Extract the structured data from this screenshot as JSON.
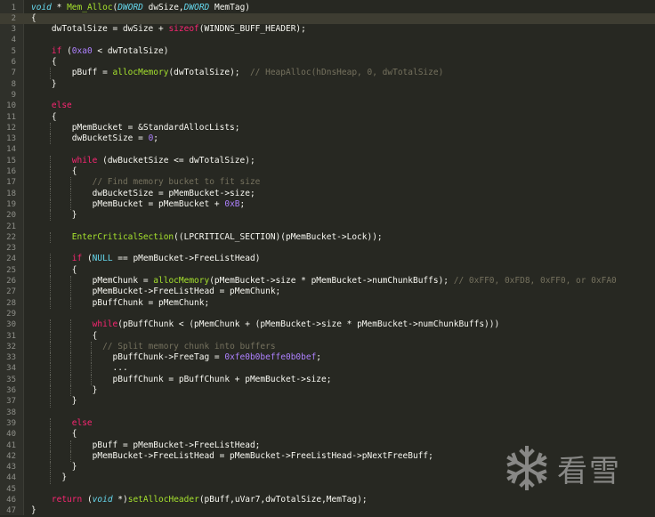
{
  "editor": {
    "current_line": 2,
    "lines": [
      {
        "n": "1",
        "t": [
          [
            "ty",
            "void"
          ],
          [
            "p",
            " * "
          ],
          [
            "fn",
            "Mem_Alloc"
          ],
          [
            "p",
            "("
          ],
          [
            "ty",
            "DWORD"
          ],
          [
            "p",
            " dwSize,"
          ],
          [
            "ty",
            "DWORD"
          ],
          [
            "p",
            " MemTag)"
          ]
        ]
      },
      {
        "n": "2",
        "t": [
          [
            "p",
            "{"
          ]
        ]
      },
      {
        "n": "3",
        "t": [
          [
            "p",
            "    dwTotalSize = dwSize + "
          ],
          [
            "kw",
            "sizeof"
          ],
          [
            "p",
            "(WINDNS_BUFF_HEADER);"
          ]
        ]
      },
      {
        "n": "4",
        "t": []
      },
      {
        "n": "5",
        "t": [
          [
            "p",
            "    "
          ],
          [
            "kw",
            "if"
          ],
          [
            "p",
            " ("
          ],
          [
            "num",
            "0xa0"
          ],
          [
            "p",
            " < dwTotalSize)"
          ]
        ]
      },
      {
        "n": "6",
        "t": [
          [
            "p",
            "    {"
          ]
        ]
      },
      {
        "n": "7",
        "t": [
          [
            "p",
            "        pBuff = "
          ],
          [
            "fn",
            "allocMemory"
          ],
          [
            "p",
            "(dwTotalSize);  "
          ],
          [
            "cmt",
            "// HeapAlloc(hDnsHeap, 0, dwTotalSize)"
          ]
        ]
      },
      {
        "n": "8",
        "t": [
          [
            "p",
            "    }"
          ]
        ]
      },
      {
        "n": "9",
        "t": []
      },
      {
        "n": "10",
        "t": [
          [
            "p",
            "    "
          ],
          [
            "kw",
            "else"
          ]
        ]
      },
      {
        "n": "11",
        "t": [
          [
            "p",
            "    {"
          ]
        ]
      },
      {
        "n": "12",
        "t": [
          [
            "p",
            "        pMemBucket = &StandardAllocLists;"
          ]
        ]
      },
      {
        "n": "13",
        "t": [
          [
            "p",
            "        dwBucketSize = "
          ],
          [
            "num",
            "0"
          ],
          [
            "p",
            ";"
          ]
        ]
      },
      {
        "n": "14",
        "t": []
      },
      {
        "n": "15",
        "t": [
          [
            "p",
            "        "
          ],
          [
            "kw",
            "while"
          ],
          [
            "p",
            " (dwBucketSize <= dwTotalSize);"
          ]
        ]
      },
      {
        "n": "16",
        "t": [
          [
            "p",
            "        {"
          ]
        ]
      },
      {
        "n": "17",
        "t": [
          [
            "p",
            "            "
          ],
          [
            "cmt",
            "// Find memory bucket to fit size"
          ]
        ]
      },
      {
        "n": "18",
        "t": [
          [
            "p",
            "            dwBucketSize = pMemBucket->size;"
          ]
        ]
      },
      {
        "n": "19",
        "t": [
          [
            "p",
            "            pMemBucket = pMemBucket + "
          ],
          [
            "num",
            "0xB"
          ],
          [
            "p",
            ";"
          ]
        ]
      },
      {
        "n": "20",
        "t": [
          [
            "p",
            "        }"
          ]
        ]
      },
      {
        "n": "21",
        "t": []
      },
      {
        "n": "22",
        "t": [
          [
            "p",
            "        "
          ],
          [
            "fn",
            "EnterCriticalSection"
          ],
          [
            "p",
            "((LPCRITICAL_SECTION)(pMemBucket->Lock));"
          ]
        ]
      },
      {
        "n": "23",
        "t": []
      },
      {
        "n": "24",
        "t": [
          [
            "p",
            "        "
          ],
          [
            "kw",
            "if"
          ],
          [
            "p",
            " ("
          ],
          [
            "nul",
            "NULL"
          ],
          [
            "p",
            " == pMemBucket->FreeListHead)"
          ]
        ]
      },
      {
        "n": "25",
        "t": [
          [
            "p",
            "        {"
          ]
        ]
      },
      {
        "n": "26",
        "t": [
          [
            "p",
            "            pMemChunk = "
          ],
          [
            "fn",
            "allocMemory"
          ],
          [
            "p",
            "(pMemBucket->size * pMemBucket->numChunkBuffs); "
          ],
          [
            "cmt",
            "// 0xFF0, 0xFD8, 0xFF0, or 0xFA0"
          ]
        ]
      },
      {
        "n": "27",
        "t": [
          [
            "p",
            "            pMemBucket->FreeListHead = pMemChunk;"
          ]
        ]
      },
      {
        "n": "28",
        "t": [
          [
            "p",
            "            pBuffChunk = pMemChunk;"
          ]
        ]
      },
      {
        "n": "29",
        "t": []
      },
      {
        "n": "30",
        "t": [
          [
            "p",
            "            "
          ],
          [
            "kw",
            "while"
          ],
          [
            "p",
            "(pBuffChunk < (pMemChunk + (pMemBucket->size * pMemBucket->numChunkBuffs)))"
          ]
        ]
      },
      {
        "n": "31",
        "t": [
          [
            "p",
            "            {"
          ]
        ]
      },
      {
        "n": "32",
        "t": [
          [
            "p",
            "              "
          ],
          [
            "cmt",
            "// Split memory chunk into buffers"
          ]
        ]
      },
      {
        "n": "33",
        "t": [
          [
            "p",
            "                pBuffChunk->FreeTag = "
          ],
          [
            "num",
            "0xfe0b0beffe0b0bef"
          ],
          [
            "p",
            ";"
          ]
        ]
      },
      {
        "n": "34",
        "t": [
          [
            "p",
            "                ..."
          ]
        ]
      },
      {
        "n": "35",
        "t": [
          [
            "p",
            "                pBuffChunk = pBuffChunk + pMemBucket->size;"
          ]
        ]
      },
      {
        "n": "36",
        "t": [
          [
            "p",
            "            }"
          ]
        ]
      },
      {
        "n": "37",
        "t": [
          [
            "p",
            "        }"
          ]
        ]
      },
      {
        "n": "38",
        "t": []
      },
      {
        "n": "39",
        "t": [
          [
            "p",
            "        "
          ],
          [
            "kw",
            "else"
          ]
        ]
      },
      {
        "n": "40",
        "t": [
          [
            "p",
            "        {"
          ]
        ]
      },
      {
        "n": "41",
        "t": [
          [
            "p",
            "            pBuff = pMemBucket->FreeListHead;"
          ]
        ]
      },
      {
        "n": "42",
        "t": [
          [
            "p",
            "            pMemBucket->FreeListHead = pMemBucket->FreeListHead->pNextFreeBuff;"
          ]
        ]
      },
      {
        "n": "43",
        "t": [
          [
            "p",
            "        }"
          ]
        ]
      },
      {
        "n": "44",
        "t": [
          [
            "p",
            "      }"
          ]
        ]
      },
      {
        "n": "45",
        "t": []
      },
      {
        "n": "46",
        "t": [
          [
            "p",
            "    "
          ],
          [
            "kw",
            "return"
          ],
          [
            "p",
            " ("
          ],
          [
            "ty",
            "void"
          ],
          [
            "p",
            " *)"
          ],
          [
            "fn",
            "setAllocHeader"
          ],
          [
            "p",
            "(pBuff,uVar7,dwTotalSize,MemTag);"
          ]
        ]
      },
      {
        "n": "47",
        "t": [
          [
            "p",
            "}"
          ]
        ]
      }
    ]
  },
  "watermark": {
    "text": "看雪",
    "icon": "snowflake-icon"
  },
  "colors": {
    "background": "#272822",
    "keyword": "#f92672",
    "type": "#66d9ef",
    "function": "#a6e22e",
    "number": "#ae81ff",
    "comment": "#75715e",
    "text": "#f8f8f2"
  }
}
